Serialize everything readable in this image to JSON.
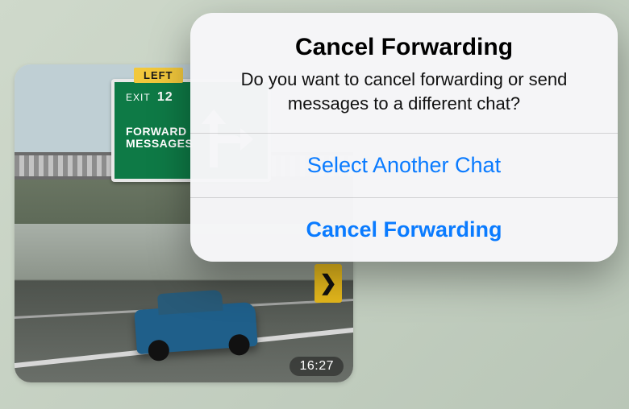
{
  "message": {
    "timestamp": "16:27",
    "sign": {
      "left_tag": "LEFT",
      "exit_label": "EXIT",
      "exit_number": "12",
      "line1": "FORWARD",
      "line2": "MESSAGES"
    }
  },
  "alert": {
    "title": "Cancel Forwarding",
    "body": "Do you want to cancel forwarding or send messages to a different chat?",
    "select_button": "Select Another Chat",
    "cancel_button": "Cancel Forwarding"
  },
  "colors": {
    "accent": "#0a7bff"
  }
}
